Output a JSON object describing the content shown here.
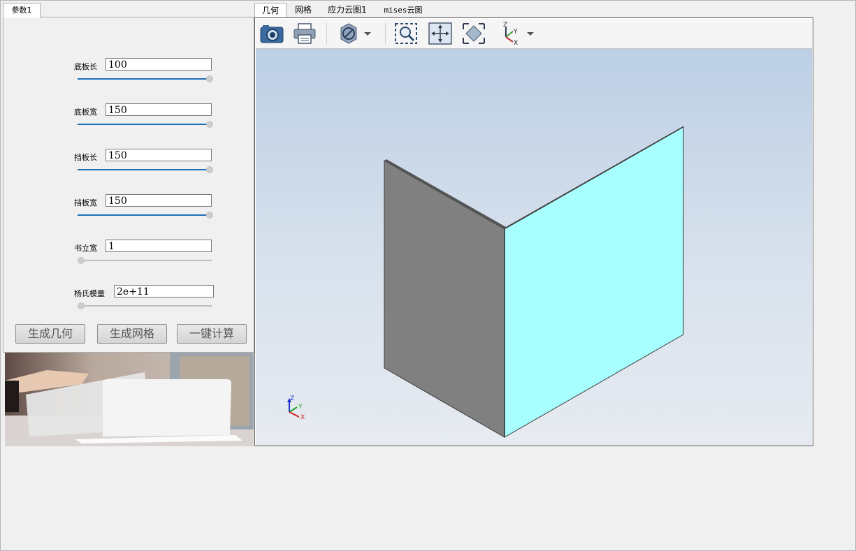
{
  "left_tab": {
    "label": "参数1"
  },
  "params": [
    {
      "label": "底板长",
      "value": "100",
      "slider": 1.0
    },
    {
      "label": "底板宽",
      "value": "150",
      "slider": 1.0
    },
    {
      "label": "挡板长",
      "value": "150",
      "slider": 1.0
    },
    {
      "label": "挡板宽",
      "value": "150",
      "slider": 1.0
    },
    {
      "label": "书立宽",
      "value": "1",
      "slider": 0.0
    },
    {
      "label": "杨氏模量",
      "value": "2e+11",
      "slider": 0.0
    }
  ],
  "buttons": {
    "generate_geometry": "生成几何",
    "generate_mesh": "生成网格",
    "one_click_compute": "一键计算"
  },
  "tabs": [
    {
      "label": "几何",
      "active": true
    },
    {
      "label": "网格",
      "active": false
    },
    {
      "label": "应力云图1",
      "active": false
    },
    {
      "label": "mises云图",
      "active": false
    }
  ],
  "toolbar": {
    "icons": [
      "camera-icon",
      "print-icon",
      "visibility-icon",
      "zoom-box-icon",
      "fit-view-icon",
      "zoom-all-icon",
      "axes-view-icon"
    ]
  },
  "viewport": {
    "triad": {
      "z": "Z",
      "y": "Y",
      "x": "X"
    },
    "colors": {
      "gray_face": "#808080",
      "cyan_face": "#a8ffff",
      "edge": "#3a3a3a"
    }
  }
}
